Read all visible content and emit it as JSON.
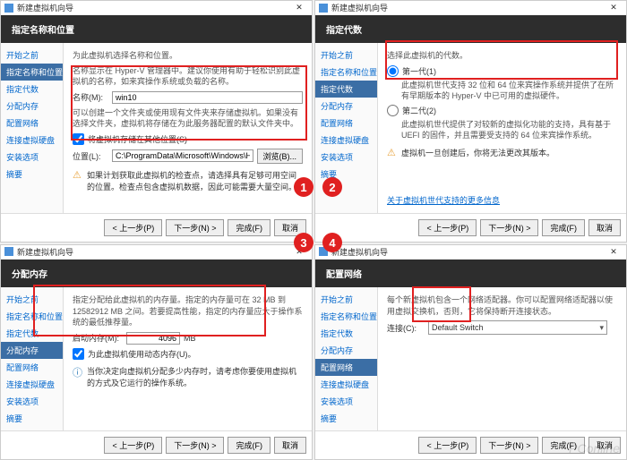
{
  "titlebar": "新建虚拟机向导",
  "close": "✕",
  "sidebar": [
    "开始之前",
    "指定名称和位置",
    "指定代数",
    "分配内存",
    "配置网络",
    "连接虚拟硬盘",
    "安装选项",
    "摘要"
  ],
  "buttons": {
    "prev": "< 上一步(P)",
    "next": "下一步(N) >",
    "finish": "完成(F)",
    "cancel": "取消",
    "browse": "浏览(B)..."
  },
  "p1": {
    "title": "指定名称和位置",
    "intro": "为此虚拟机选择名称和位置。",
    "desc": "名称显示在 Hyper-V 管理器中。建议你使用有助于轻松识别此虚拟机的名称，如来宾操作系统或负载的名称。",
    "nameLabel": "名称(M):",
    "nameValue": "win10",
    "locDesc": "可以创建一个文件夹或使用现有文件夹来存储虚拟机。如果没有选择文件夹，虚拟机将存储在为此服务器配置的默认文件夹中。",
    "storeCheck": "将虚拟机存储在其他位置(S)",
    "locLabel": "位置(L):",
    "locValue": "C:\\ProgramData\\Microsoft\\Windows\\Hyper-V\\",
    "warn": "如果计划获取此虚拟机的检查点，请选择具有足够可用空间的位置。检查点包含虚拟机数据，因此可能需要大量空间。"
  },
  "p2": {
    "title": "指定代数",
    "intro": "选择此虚拟机的代数。",
    "g1": "第一代(1)",
    "g1desc": "此虚拟机世代支持 32 位和 64 位来宾操作系统并提供了在所有早期版本的 Hyper-V 中已可用的虚拟硬件。",
    "g2": "第二代(2)",
    "g2desc": "此虚拟机世代提供了对较新的虚拟化功能的支持，具有基于 UEFI 的固件，并且需要受支持的 64 位来宾操作系统。",
    "warn": "虚拟机一旦创建后，你将无法更改其版本。",
    "link": "关于虚拟机世代支持的更多信息"
  },
  "p3": {
    "title": "分配内存",
    "intro": "指定分配给此虚拟机的内存量。指定的内存量可在 32 MB 到 12582912 MB 之间。若要提高性能，指定的内存量应大于操作系统的最低推荐量。",
    "memLabel": "启动内存(M):",
    "memValue": "4096",
    "memUnit": "MB",
    "dynCheck": "为此虚拟机使用动态内存(U)。",
    "info": "当你决定向虚拟机分配多少内存时，请考虑你要使用虚拟机的方式及它运行的操作系统。"
  },
  "p4": {
    "title": "配置网络",
    "intro": "每个新虚拟机包含一个网络适配器。你可以配置网络适配器以使用虚拟交换机，否则，它将保持断开连接状态。",
    "connLabel": "连接(C):",
    "connValue": "Default Switch"
  },
  "badges": [
    "1",
    "2",
    "3",
    "4"
  ],
  "watermark": "PConline"
}
